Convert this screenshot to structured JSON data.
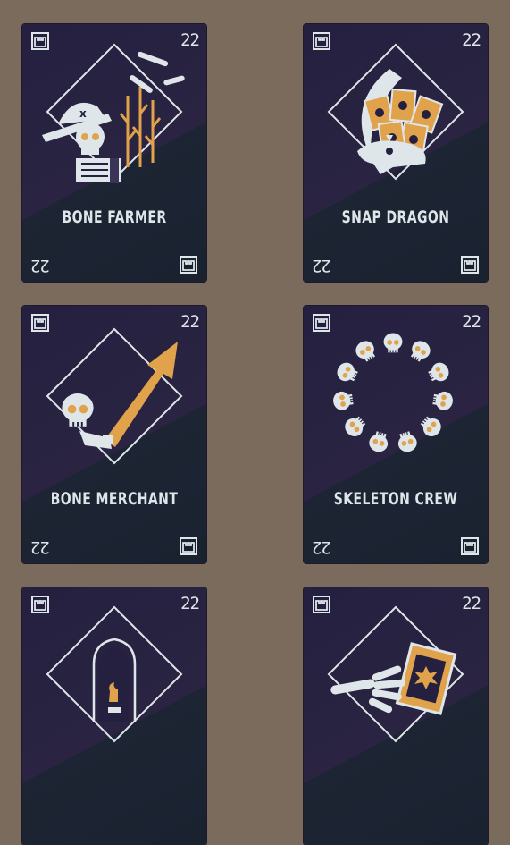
{
  "cards": [
    {
      "title": "BONE FARMER",
      "number": "22",
      "art_icon": "skeleton-farmer-icon"
    },
    {
      "title": "SNAP DRAGON",
      "number": "22",
      "art_icon": "dragon-skull-icon"
    },
    {
      "title": "BONE MERCHANT",
      "number": "22",
      "art_icon": "skull-arrow-icon"
    },
    {
      "title": "SKELETON CREW",
      "number": "22",
      "art_icon": "skull-circle-icon"
    },
    {
      "title": "",
      "number": "22",
      "art_icon": "tombstone-icon"
    },
    {
      "title": "",
      "number": "22",
      "art_icon": "skeleton-hand-card-icon"
    }
  ],
  "colors": {
    "background": "#7a6b5c",
    "card_dark": "#252040",
    "card_dark_lower": "#1a2230",
    "bone": "#dfe6ea",
    "accent_orange": "#e0a24a"
  },
  "corner_icon": "castle-glyph-icon"
}
